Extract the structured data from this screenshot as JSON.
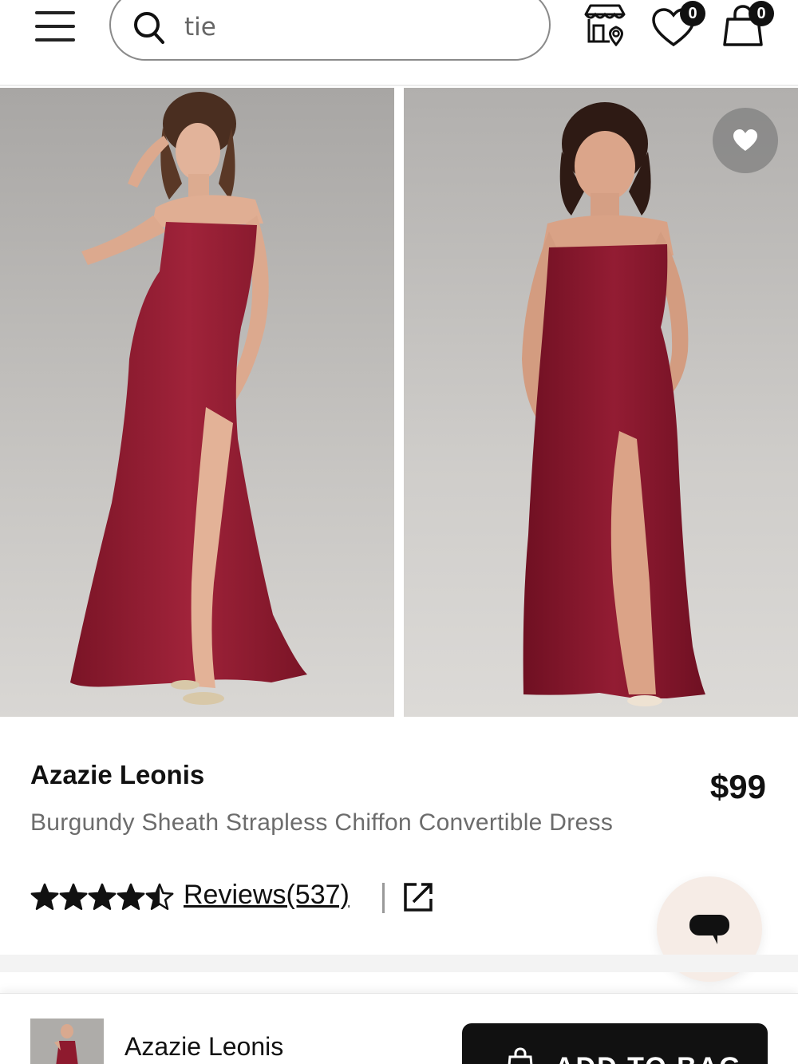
{
  "header": {
    "search_value": "tie",
    "wishlist_count": "0",
    "bag_count": "0",
    "icons": [
      "menu-icon",
      "search-icon",
      "store-locator-icon",
      "heart-icon",
      "bag-icon"
    ]
  },
  "product": {
    "brand": "Azazie Leonis",
    "title": "Burgundy Sheath Strapless Chiffon Convertible Dress",
    "price": "$99",
    "rating": 4.5,
    "reviews_label": "Reviews(537)",
    "dress_color": "#8e1a2e"
  },
  "sticky_bar": {
    "brand": "Azazie Leonis",
    "add_to_bag_label": "ADD TO BAG"
  }
}
